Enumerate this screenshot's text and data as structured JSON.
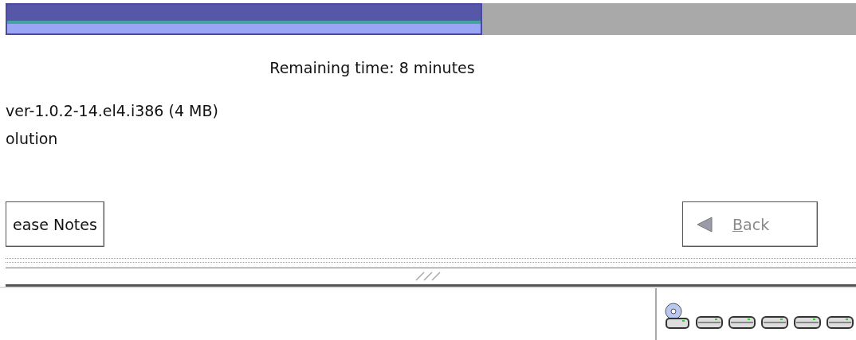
{
  "progress": {
    "level": 0.56
  },
  "remaining_time": "Remaining time: 8 minutes",
  "package_lines": [
    "ver-1.0.2-14.el4.i386 (4 MB)",
    "olution"
  ],
  "buttons": [
    {
      "label": "ease Notes",
      "disabled": false
    },
    {
      "label": "Back",
      "disabled": true,
      "first_letter_underlined": true
    }
  ],
  "status_bar": {
    "devices": [
      {
        "kind": "cdrom"
      },
      {
        "kind": "disk"
      },
      {
        "kind": "disk"
      },
      {
        "kind": "disk"
      },
      {
        "kind": "disk"
      },
      {
        "kind": "disk"
      }
    ]
  }
}
